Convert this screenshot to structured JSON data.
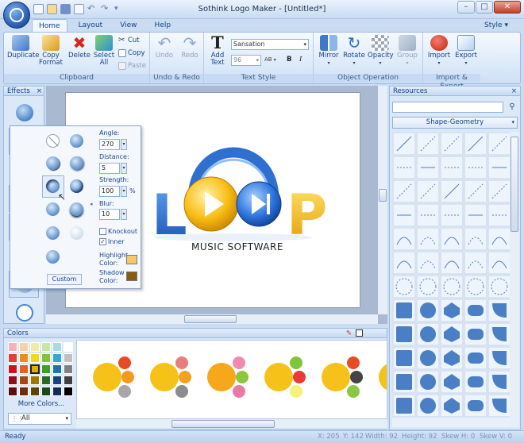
{
  "window": {
    "title": "Sothink Logo Maker - [Untitled*]",
    "minimize": "–",
    "maximize": "□",
    "close": "✕"
  },
  "tabs": [
    "Home",
    "Layout",
    "View",
    "Help"
  ],
  "style_label": "Style",
  "ribbon": {
    "clipboard": {
      "label": "Clipboard",
      "duplicate": "Duplicate",
      "copy_format_1": "Copy",
      "copy_format_2": "Format",
      "delete": "Delete",
      "select_all_1": "Select",
      "select_all_2": "All",
      "cut": "Cut",
      "copy": "Copy",
      "paste": "Paste"
    },
    "undo_redo": {
      "label": "Undo & Redo",
      "undo": "Undo",
      "redo": "Redo"
    },
    "text_style": {
      "label": "Text Style",
      "add_text_1": "Add",
      "add_text_2": "Text",
      "font": "Sansation",
      "size": "96",
      "char_spacing": "AB",
      "bold": "B",
      "italic": "I"
    },
    "object_operation": {
      "label": "Object Operation",
      "mirror": "Mirror",
      "rotate": "Rotate",
      "opacity": "Opacity",
      "group": "Group"
    },
    "import_export": {
      "label": "Import & Export",
      "import": "Import",
      "export": "Export"
    }
  },
  "effects_panel": {
    "title": "Effects",
    "close": "×"
  },
  "effect_popup": {
    "angle_label": "Angle:",
    "angle": "270",
    "distance_label": "Distance:",
    "distance": "5",
    "strength_label": "Strength:",
    "strength": "100",
    "strength_unit": "%",
    "blur_label": "Blur:",
    "blur": "10",
    "knockout_label": "Knockout",
    "knockout": false,
    "inner_label": "Inner",
    "inner": true,
    "highlight_label_1": "Highlight",
    "highlight_label_2": "Color:",
    "highlight_color": "#f6c86a",
    "shadow_label_1": "Shadow",
    "shadow_label_2": "Color:",
    "shadow_color": "#8a5a10",
    "custom": "Custom"
  },
  "logo": {
    "letter_l": "L",
    "letter_p": "P",
    "tagline": "MUSIC SOFTWARE"
  },
  "resources_panel": {
    "title": "Resources",
    "close": "×",
    "category": "Shape-Geometry"
  },
  "colors_panel": {
    "title": "Colors",
    "more_colors": "More Colors...",
    "filter": "All"
  },
  "status": {
    "ready": "Ready",
    "x": "X: 205",
    "y": "Y: 142",
    "width": "Width: 92",
    "height": "Height: 92",
    "skew_h": "Skew H: 0",
    "skew_v": "Skew V: 0"
  },
  "colors": {
    "accent": "#1f5fbf",
    "ribbon": "#dae8f8",
    "logo_blue": "#2f6fd0",
    "logo_yellow": "#f6b500"
  }
}
